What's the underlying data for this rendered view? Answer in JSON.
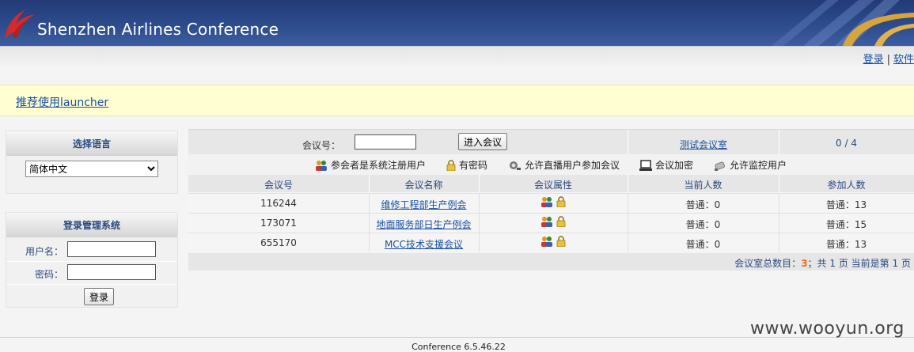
{
  "header": {
    "title": "Shenzhen Airlines Conference"
  },
  "topbar": {
    "login_link": "登录",
    "separator": "|",
    "software_link": "软件"
  },
  "notice": {
    "launcher_link": "推荐使用launcher"
  },
  "language_panel": {
    "title": "选择语言",
    "selected": "简体中文"
  },
  "login_panel": {
    "title": "登录管理系统",
    "username_label": "用户名：",
    "password_label": "密码：",
    "login_button": "登录"
  },
  "search": {
    "conf_no_label": "会议号：",
    "conf_no_value": "",
    "enter_button": "进入会议",
    "test_room_link": "测试会议室",
    "online_count": "0 / 4"
  },
  "legend": [
    {
      "icon": "users-icon",
      "label": "参会者是系统注册用户"
    },
    {
      "icon": "lock-icon",
      "label": "有密码"
    },
    {
      "icon": "broadcast-icon",
      "label": "允许直播用户参加会议"
    },
    {
      "icon": "monitor-icon",
      "label": "会议加密"
    },
    {
      "icon": "camera-icon",
      "label": "允许监控用户"
    }
  ],
  "table": {
    "headers": [
      "会议号",
      "会议名称",
      "会议属性",
      "当前人数",
      "参加人数"
    ],
    "rows": [
      {
        "id": "116244",
        "name": "维修工程部生产例会",
        "current": "普通：0",
        "joined": "普通：13"
      },
      {
        "id": "173071",
        "name": "地面服务部日生产例会",
        "current": "普通：0",
        "joined": "普通：15"
      },
      {
        "id": "655170",
        "name": "MCC技术支援会议",
        "current": "普通：0",
        "joined": "普通：13"
      }
    ]
  },
  "pagination": {
    "prefix": "会议室总数目：",
    "total": "3",
    "middle": "；共",
    "pages": "1",
    "pages_suffix": "页 当前是第",
    "current": "1",
    "current_suffix": "页"
  },
  "footer": {
    "version": "Conference 6.5.46.22"
  },
  "watermark": "www.wooyun.org"
}
